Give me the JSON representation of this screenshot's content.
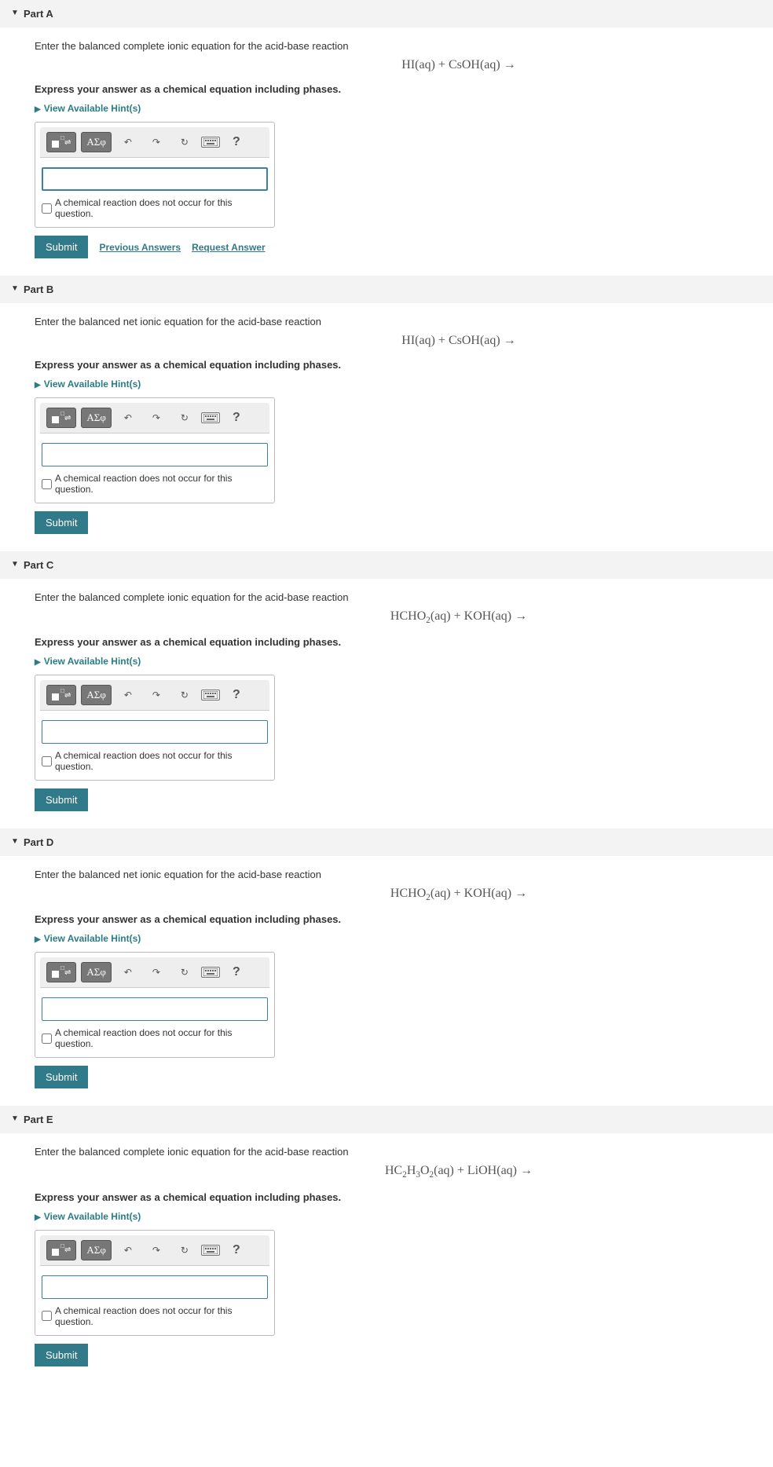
{
  "common": {
    "instruction": "Express your answer as a chemical equation including phases.",
    "hints_label": "View Available Hint(s)",
    "checkbox_label": "A chemical reaction does not occur for this question.",
    "submit_label": "Submit",
    "prev_answers_label": "Previous Answers",
    "request_answer_label": "Request Answer",
    "toolbar": {
      "template_tip": "Templates",
      "greek_tip": "ΑΣφ",
      "undo_tip": "↶",
      "redo_tip": "↷",
      "reset_tip": "↻",
      "keyboard_tip": "⌨",
      "help_tip": "?"
    }
  },
  "parts": [
    {
      "title": "Part A",
      "prompt": "Enter the balanced complete ionic equation for the acid-base reaction",
      "equation_html": "HI(aq) + CsOH(aq) →",
      "has_links": true,
      "focused": true
    },
    {
      "title": "Part B",
      "prompt": "Enter the balanced net ionic equation for the acid-base reaction",
      "equation_html": "HI(aq)  +  CsOH(aq) →",
      "has_links": false,
      "focused": false
    },
    {
      "title": "Part C",
      "prompt": "Enter the balanced complete ionic equation for the acid-base reaction",
      "equation_html": "HCHO<sub>2</sub>(aq)  +  KOH(aq) →",
      "has_links": false,
      "focused": false
    },
    {
      "title": "Part D",
      "prompt": "Enter the balanced net ionic equation for the acid-base reaction",
      "equation_html": "HCHO<sub>2</sub>(aq)  +  KOH(aq) →",
      "has_links": false,
      "focused": false
    },
    {
      "title": "Part E",
      "prompt": "Enter the balanced complete ionic equation for the acid-base reaction",
      "equation_html": "HC<sub>2</sub>H<sub>3</sub>O<sub>2</sub>(aq)  +  LiOH(aq) →",
      "has_links": false,
      "focused": false
    }
  ]
}
